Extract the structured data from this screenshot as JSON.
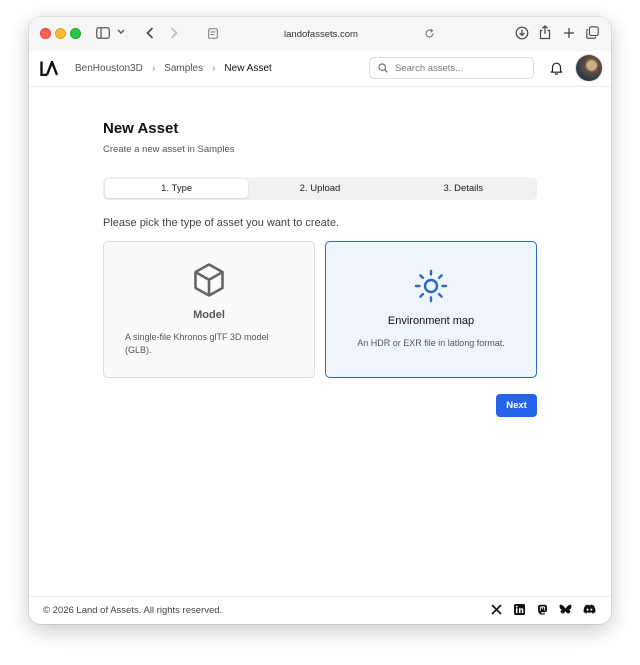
{
  "browser": {
    "url": "landofassets.com"
  },
  "header": {
    "breadcrumbs": [
      "BenHouston3D",
      "Samples",
      "New Asset"
    ],
    "search_placeholder": "Search assets..."
  },
  "page": {
    "title": "New Asset",
    "subtitle": "Create a new asset in Samples",
    "steps": [
      {
        "label": "1. Type",
        "active": true
      },
      {
        "label": "2. Upload",
        "active": false
      },
      {
        "label": "3. Details",
        "active": false
      }
    ],
    "prompt": "Please pick the type of asset you want to create.",
    "options": [
      {
        "title": "Model",
        "description": "A single-file Khronos glTF 3D model (GLB).",
        "icon": "cube-icon",
        "selected": false
      },
      {
        "title": "Environment map",
        "description": "An HDR or EXR file in latlong format.",
        "icon": "sun-icon",
        "selected": true
      }
    ],
    "next_label": "Next"
  },
  "footer": {
    "copyright": "© 2026 Land of Assets. All rights reserved.",
    "social_icons": [
      "x-icon",
      "linkedin-icon",
      "mastodon-icon",
      "bluesky-icon",
      "discord-icon"
    ]
  },
  "colors": {
    "accent": "#2563eb",
    "selected_border": "#2d66c4",
    "selected_bg": "#eff5fd"
  }
}
